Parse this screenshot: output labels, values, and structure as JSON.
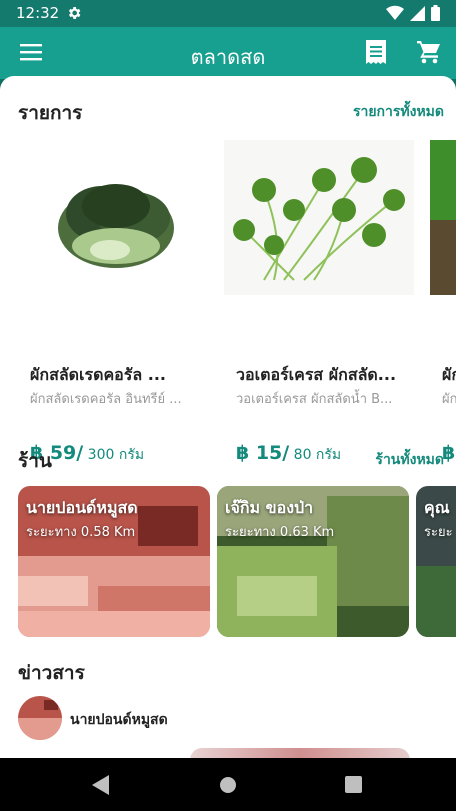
{
  "status_bar": {
    "time": "12:32"
  },
  "app_bar": {
    "title": "ตลาดสด"
  },
  "products_section": {
    "title": "รายการ",
    "see_all": "รายการทั้งหมด",
    "items": [
      {
        "name": "ผักสลัดเรดคอรัล ...",
        "desc": "ผักสลัดเรดคอรัล อินทรีย์ ...",
        "price": "฿ 59/",
        "unit": " 300 กรัม"
      },
      {
        "name": "วอเตอร์เครส ผักสลัด...",
        "desc": "วอเตอร์เครส ผักสลัดน้ำ B...",
        "price": "฿ 15/",
        "unit": " 80 กรัม"
      },
      {
        "name": "ผัก",
        "desc": "ผัก",
        "price": "฿",
        "unit": ""
      }
    ]
  },
  "shops_section": {
    "title": "ร้าน",
    "see_all": "ร้านทั้งหมด",
    "items": [
      {
        "name": "นายปอนด์หมูสด",
        "distance": "ระยะทาง 0.58 Km"
      },
      {
        "name": "เจ๊กิม ของป่า",
        "distance": "ระยะทาง 0.63 Km"
      },
      {
        "name": "คุณ",
        "distance": "ระยะ"
      }
    ]
  },
  "news_section": {
    "title": "ข่าวสาร",
    "author": "นายปอนด์หมูสด"
  },
  "colors": {
    "primary": "#17a08f",
    "status": "#147a6e",
    "accent_text": "#148a7c"
  }
}
